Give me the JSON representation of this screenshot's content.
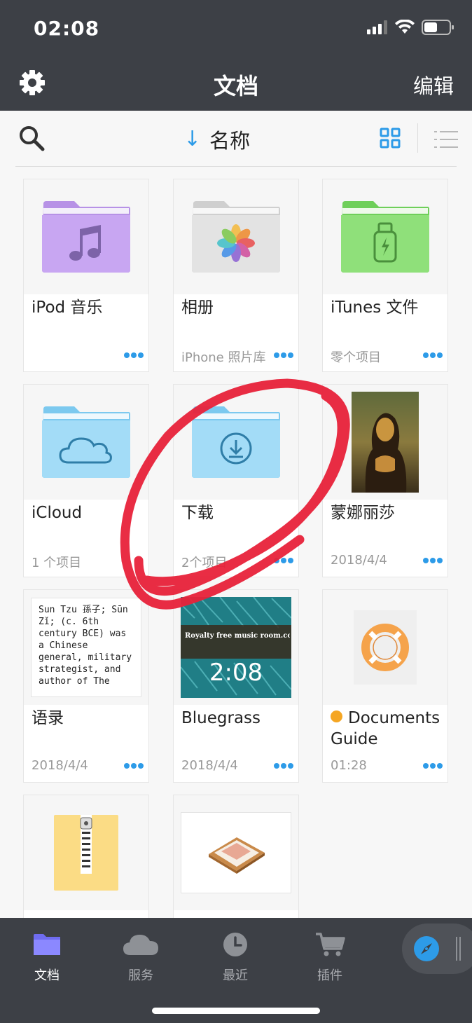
{
  "status_bar": {
    "time": "02:08"
  },
  "nav": {
    "title": "文档",
    "edit_label": "编辑"
  },
  "toolbar": {
    "sort_label": "名称",
    "sort_arrow": "↓"
  },
  "files": [
    {
      "name": "iPod 音乐",
      "sub": "",
      "thumb": "folder-music"
    },
    {
      "name": "相册",
      "sub": "iPhone 照片库",
      "thumb": "folder-photos"
    },
    {
      "name": "iTunes 文件",
      "sub": "零个项目",
      "thumb": "folder-usb"
    },
    {
      "name": "iCloud",
      "sub": "1 个项目",
      "thumb": "folder-cloud"
    },
    {
      "name": "下载",
      "sub": "2个项目",
      "thumb": "folder-download"
    },
    {
      "name": "蒙娜丽莎",
      "sub": "2018/4/4",
      "thumb": "image-painting"
    },
    {
      "name": "语录",
      "sub": "2018/4/4",
      "thumb": "text-preview",
      "preview": "Sun Tzu 孫子; Sūn Zǐ; (c. 6th century BCE) was a Chinese general, military strategist, and author of The"
    },
    {
      "name": "Bluegrass",
      "sub": "2018/4/4",
      "thumb": "video",
      "duration": "2:08",
      "video_caption": "Royalty free music room.com"
    },
    {
      "name": "Documents Guide",
      "sub": "01:28",
      "thumb": "lifebuoy"
    },
    {
      "name": "",
      "sub": "",
      "thumb": "zip"
    },
    {
      "name": "",
      "sub": "",
      "thumb": "tray"
    }
  ],
  "tabs": [
    {
      "label": "文档",
      "icon": "folder-icon",
      "active": true
    },
    {
      "label": "服务",
      "icon": "cloud-icon",
      "active": false
    },
    {
      "label": "最近",
      "icon": "clock-icon",
      "active": false
    },
    {
      "label": "插件",
      "icon": "cart-icon",
      "active": false
    }
  ],
  "colors": {
    "accent": "#2d9be8",
    "bar": "#3d4046",
    "annotation": "#e8223a"
  }
}
